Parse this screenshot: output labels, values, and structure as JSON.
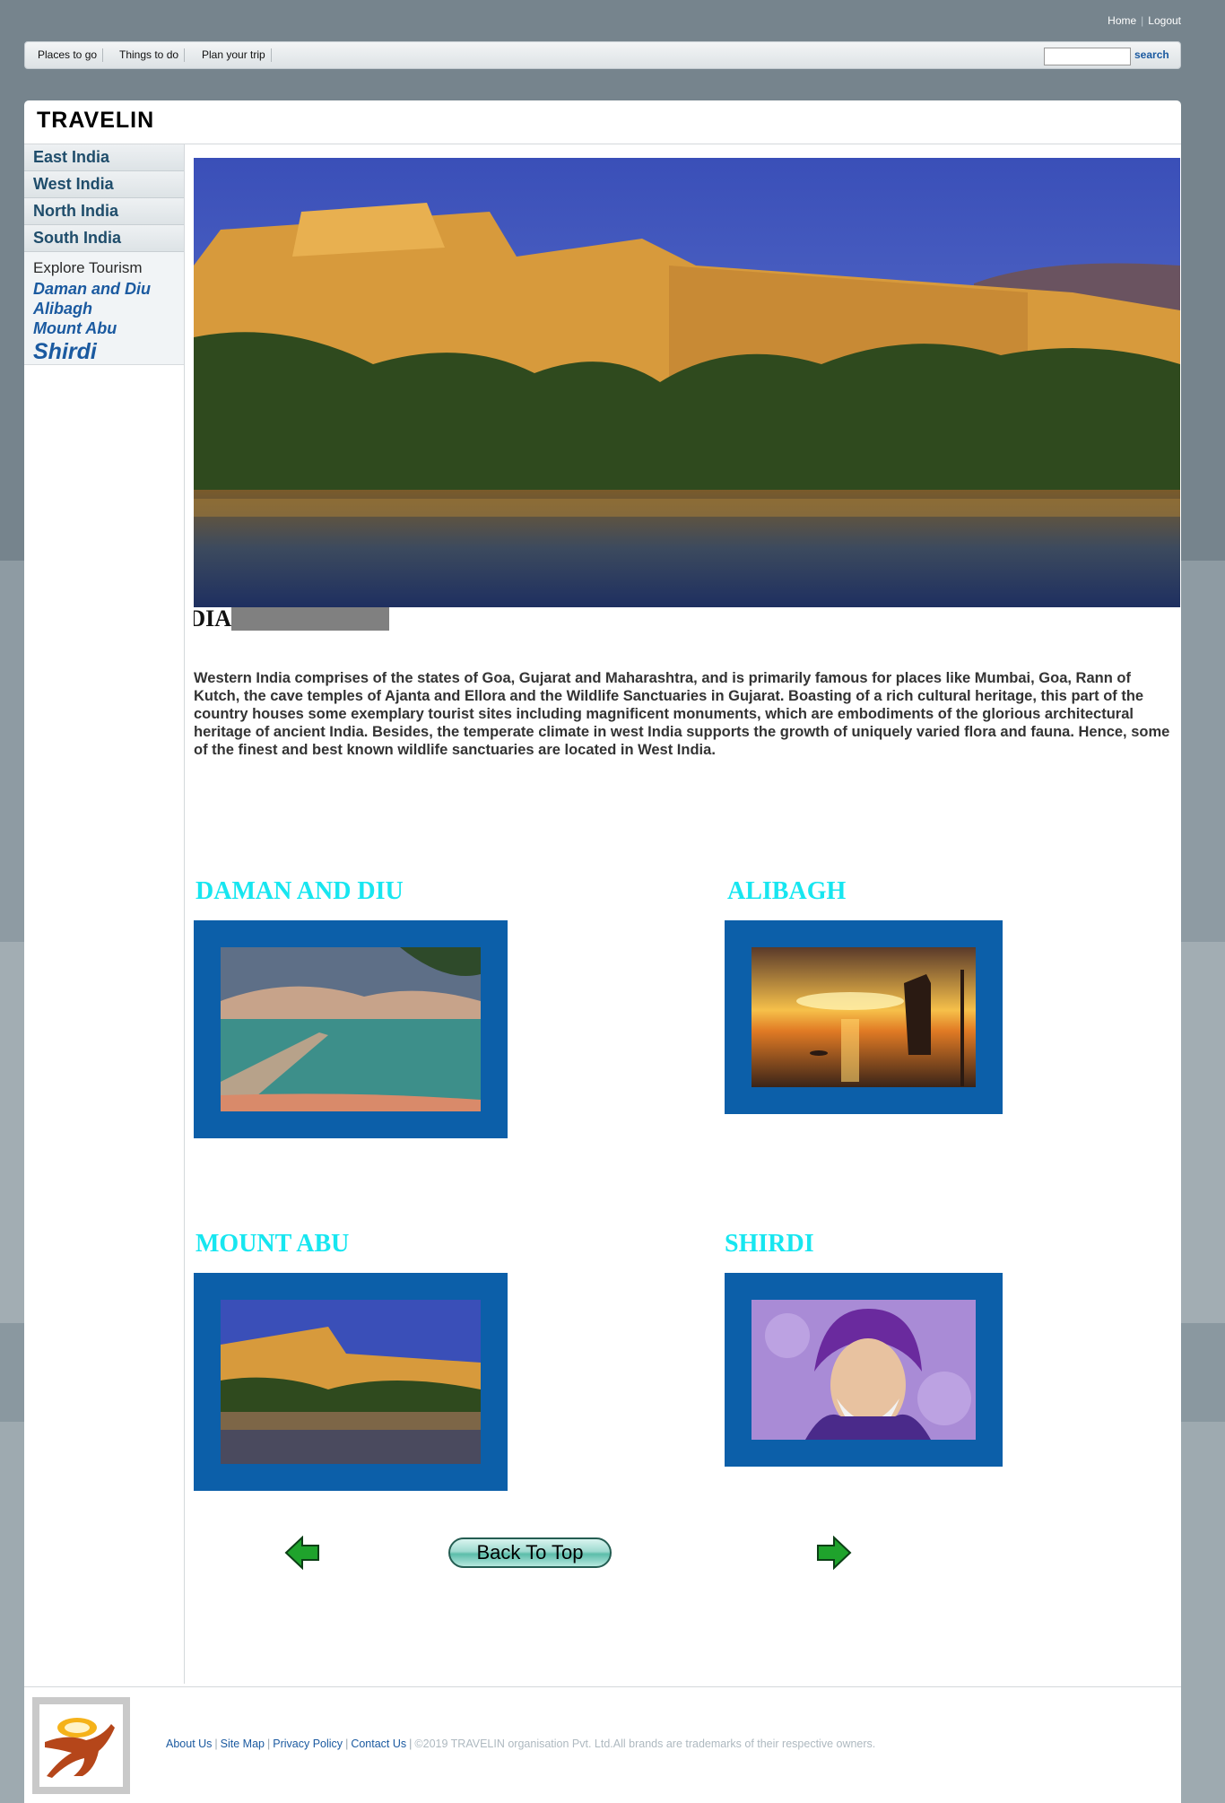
{
  "top_links": {
    "home": "Home",
    "logout": "Logout"
  },
  "nav": {
    "items": [
      "Places to go",
      "Things to do",
      "Plan your trip"
    ],
    "search_button": "search",
    "search_value": ""
  },
  "brand": {
    "name": "TRAVELIN"
  },
  "sidebar": {
    "regions": [
      "East India",
      "West India",
      "North India",
      "South India"
    ],
    "explore_title": "Explore Tourism",
    "explore_links": [
      "Daman and Diu",
      "Alibagh",
      "Mount Abu",
      "Shirdi"
    ]
  },
  "hero": {
    "caption": "WEST INDIA"
  },
  "intro": "Western India comprises of the states of Goa, Gujarat and Maharashtra, and is primarily famous for places like Mumbai, Goa, Rann of Kutch, the cave temples of Ajanta and Ellora and the Wildlife Sanctuaries in Gujarat. Boasting of a rich cultural heritage, this part of the country houses some exemplary tourist sites including magnificent monuments, which are embodiments of the glorious architectural heritage of ancient India. Besides, the temperate climate in west India supports the growth of uniquely varied flora and fauna. Hence, some of the finest and best known wildlife sanctuaries are located in West India.",
  "destinations": [
    {
      "title": "DAMAN AND DIU",
      "image": "pier-sea-photo"
    },
    {
      "title": "ALIBAGH",
      "image": "sunset-lantern-photo"
    },
    {
      "title": "MOUNT ABU",
      "image": "lake-palace-photo"
    },
    {
      "title": "SHIRDI",
      "image": "sai-baba-portrait"
    }
  ],
  "bottom_nav": {
    "back_to_top": "Back To Top",
    "prev_icon": "left-arrow-icon",
    "next_icon": "right-arrow-icon"
  },
  "footer": {
    "links": [
      "About Us",
      "Site Map",
      "Privacy Policy",
      "Contact Us"
    ],
    "copyright": "©2019 TRAVELIN organisation Pvt. Ltd.All brands are trademarks of their respective owners."
  },
  "colors": {
    "accent_blue": "#0c5fa9",
    "title_cyan": "#17e6f0",
    "link_blue": "#1b5aa0"
  }
}
